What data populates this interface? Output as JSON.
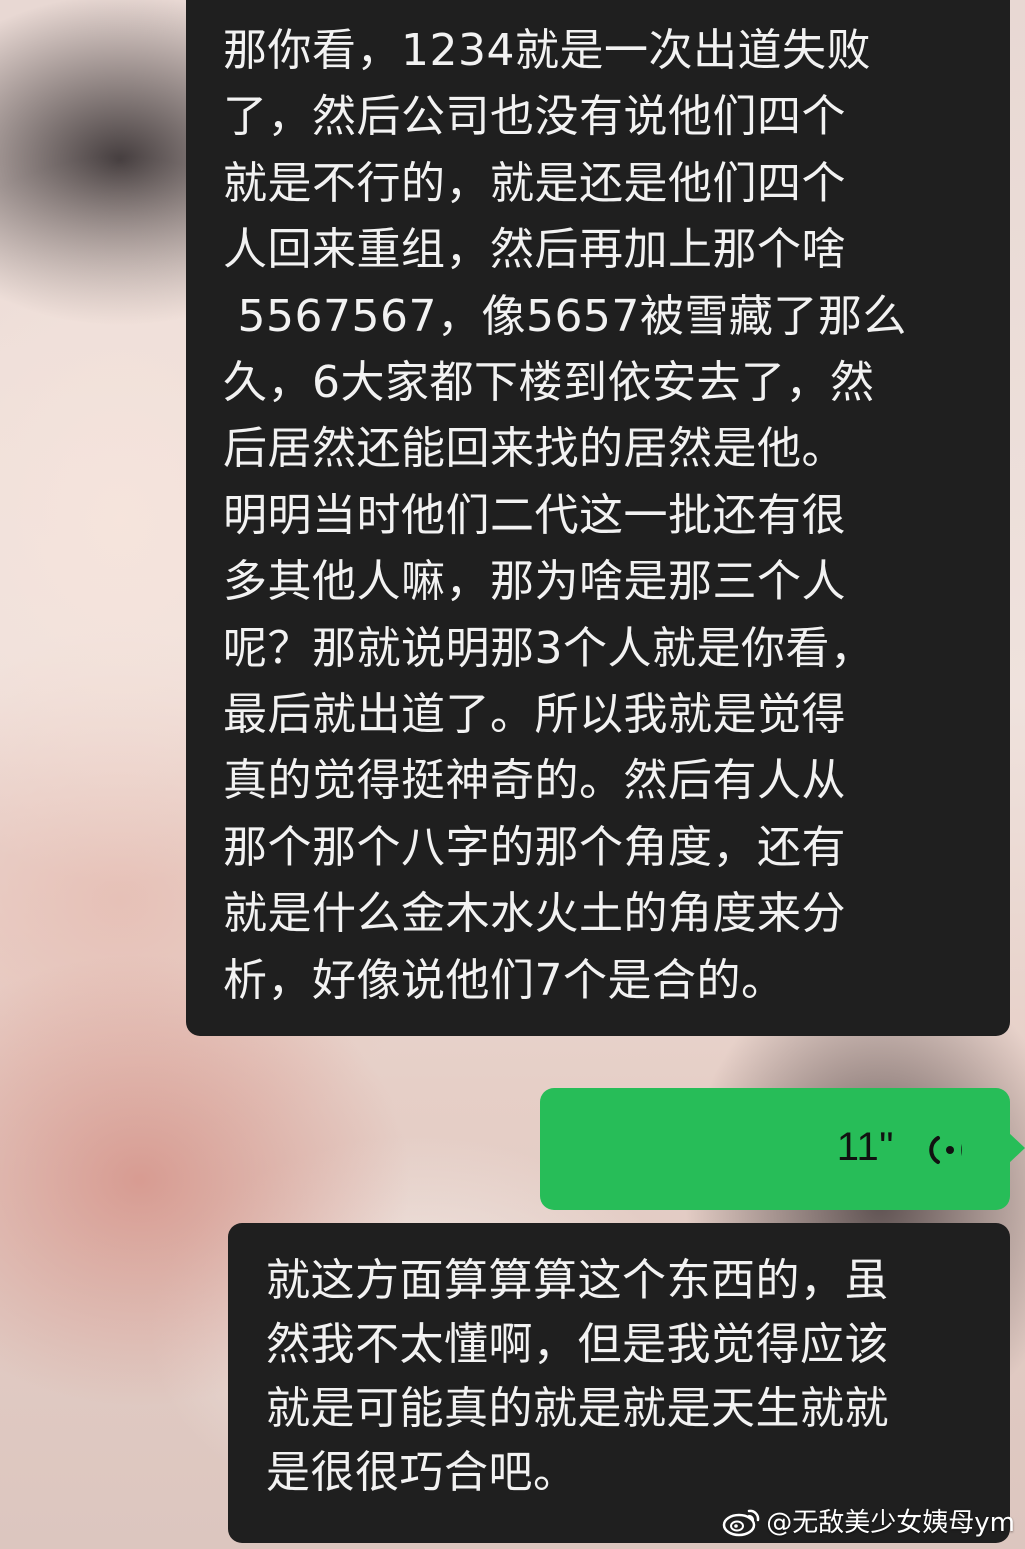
{
  "messages": [
    {
      "side": "received",
      "text": "那你看，1234就是一次出道失败\n了，然后公司也没有说他们四个\n就是不行的，就是还是他们四个\n人回来重组，然后再加上那个啥\n 5567567，像5657被雪藏了那么\n久，6大家都下楼到依安去了，然\n后居然还能回来找的居然是他。\n明明当时他们二代这一批还有很\n多其他人嘛，那为啥是那三个人\n呢？那就说明那3个人就是你看，\n最后就出道了。所以我就是觉得\n真的觉得挺神奇的。然后有人从\n那个那个八字的那个角度，还有\n就是什么金木水火土的角度来分\n析，好像说他们7个是合的。"
    },
    {
      "side": "sent",
      "type": "voice",
      "duration": "11\""
    },
    {
      "side": "received",
      "text": "就这方面算算算这个东西的，虽\n然我不太懂啊，但是我觉得应该\n就是可能真的就是就是天生就就\n是很很巧合吧。"
    }
  ],
  "watermark": {
    "text": "@无敌美少女姨母ym",
    "icon": "weibo-icon"
  },
  "colors": {
    "received_bubble": "#1f1f1f",
    "sent_bubble": "#27bd58",
    "received_text": "#f2f2f2"
  }
}
